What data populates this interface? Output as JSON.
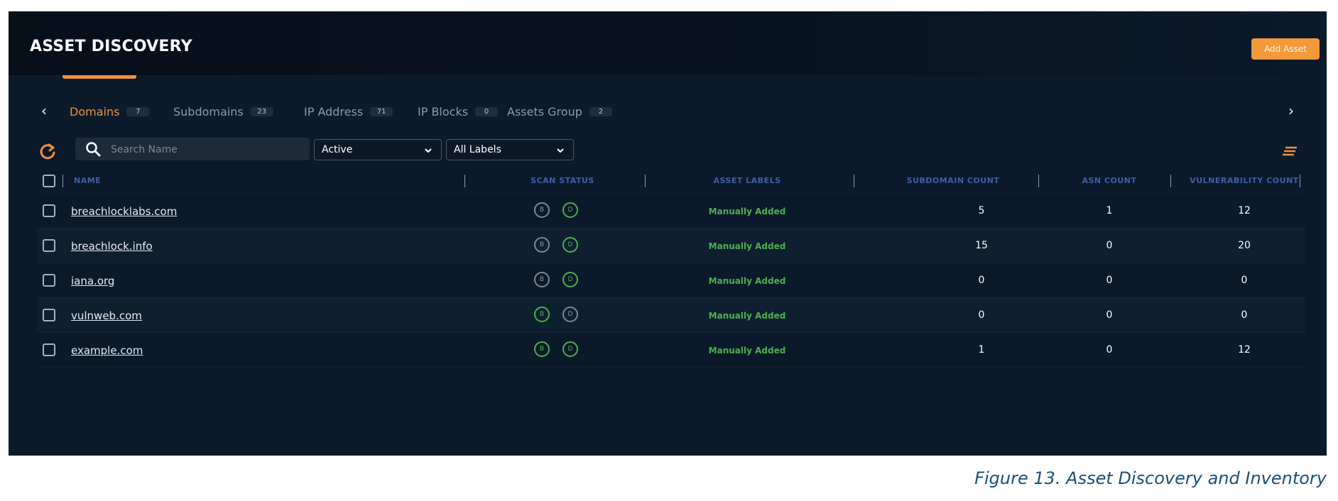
{
  "header": {
    "title": "ASSET DISCOVERY",
    "add_button_label": "Add Asset"
  },
  "tabs": [
    {
      "label": "Domains",
      "count": "7",
      "active": true
    },
    {
      "label": "Subdomains",
      "count": "23",
      "active": false
    },
    {
      "label": "IP Address",
      "count": "71",
      "active": false
    },
    {
      "label": "IP Blocks",
      "count": "0",
      "active": false
    },
    {
      "label": "Assets Group",
      "count": "2",
      "active": false
    }
  ],
  "toolbar": {
    "search_placeholder": "Search Name",
    "status_filter": "Active",
    "labels_filter": "All Labels"
  },
  "table": {
    "columns": [
      "NAME",
      "SCAN STATUS",
      "ASSET LABELS",
      "SUBDOMAIN COUNT",
      "ASN COUNT",
      "VULNERABILITY COUNT"
    ],
    "rows": [
      {
        "name": "breachlocklabs.com",
        "scan_b": "B",
        "scan_d": "D",
        "scan_b_state": "gray",
        "scan_d_state": "green",
        "label": "Manually Added",
        "subdomain_count": "5",
        "asn_count": "1",
        "vulnerability_count": "12"
      },
      {
        "name": "breachlock.info",
        "scan_b": "B",
        "scan_d": "D",
        "scan_b_state": "gray",
        "scan_d_state": "green",
        "label": "Manually Added",
        "subdomain_count": "15",
        "asn_count": "0",
        "vulnerability_count": "20"
      },
      {
        "name": "iana.org",
        "scan_b": "B",
        "scan_d": "D",
        "scan_b_state": "gray",
        "scan_d_state": "green",
        "label": "Manually Added",
        "subdomain_count": "0",
        "asn_count": "0",
        "vulnerability_count": "0"
      },
      {
        "name": "vulnweb.com",
        "scan_b": "B",
        "scan_d": "D",
        "scan_b_state": "green",
        "scan_d_state": "gray",
        "label": "Manually Added",
        "subdomain_count": "0",
        "asn_count": "0",
        "vulnerability_count": "0"
      },
      {
        "name": "example.com",
        "scan_b": "B",
        "scan_d": "D",
        "scan_b_state": "green",
        "scan_d_state": "green",
        "label": "Manually Added",
        "subdomain_count": "1",
        "asn_count": "0",
        "vulnerability_count": "12"
      }
    ]
  },
  "caption": "Figure 13. Asset Discovery and Inventory",
  "colors": {
    "accent": "#f0913a",
    "status_green": "#4caf50",
    "background": "#0b1a2a",
    "header_text": "#3e5fa4"
  }
}
